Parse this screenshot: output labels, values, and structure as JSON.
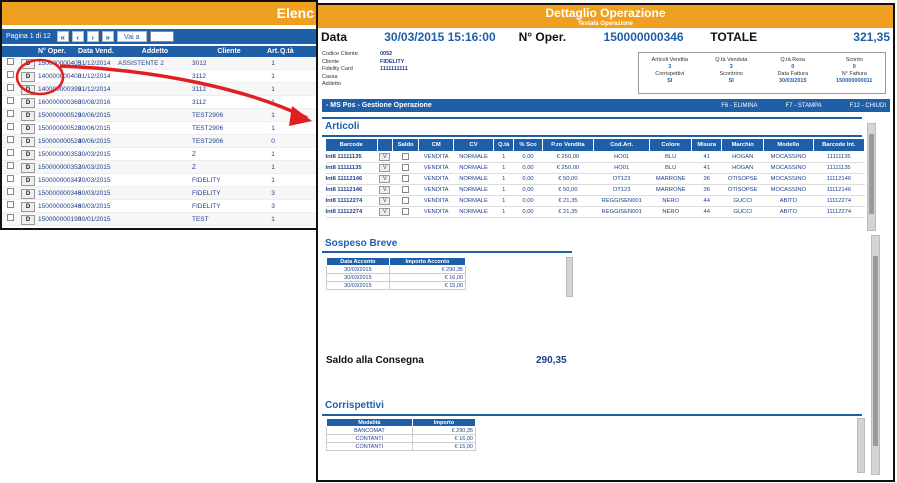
{
  "left": {
    "title": "Elenc",
    "pager": {
      "text": "Pagina 1 di 12",
      "first": "«",
      "prev": "‹",
      "next": "›",
      "last": "»",
      "goto": "Vai a",
      "goto_value": ""
    },
    "columns": [
      "",
      "",
      "N° Oper.",
      "Data Vend.",
      "Addetto",
      "Cliente",
      "Art.",
      "Q.tà"
    ],
    "rows": [
      {
        "d": "D",
        "op": "150000000405",
        "data": "31/12/2014",
        "addetto": "ASSISTENTE 2",
        "cliente": "3012",
        "art": "1"
      },
      {
        "d": "D",
        "op": "140000000400",
        "data": "31/12/2014",
        "addetto": "",
        "cliente": "3112",
        "art": "1"
      },
      {
        "d": "D",
        "op": "140000000399",
        "data": "31/12/2014",
        "addetto": "",
        "cliente": "3112",
        "art": "1"
      },
      {
        "d": "D",
        "op": "160000000360",
        "data": "30/08/2016",
        "addetto": "",
        "cliente": "3112",
        "art": "1"
      },
      {
        "d": "D",
        "op": "150000000529",
        "data": "30/06/2015",
        "addetto": "",
        "cliente": "TEST2906",
        "art": "1"
      },
      {
        "d": "D",
        "op": "150000000528",
        "data": "30/06/2015",
        "addetto": "",
        "cliente": "TEST2906",
        "art": "1"
      },
      {
        "d": "D",
        "op": "150000000524",
        "data": "30/06/2015",
        "addetto": "",
        "cliente": "TEST2906",
        "art": "0"
      },
      {
        "d": "D",
        "op": "150000000353",
        "data": "30/03/2015",
        "addetto": "",
        "cliente": "Z",
        "art": "1"
      },
      {
        "d": "D",
        "op": "150000000352",
        "data": "30/03/2015",
        "addetto": "",
        "cliente": "Z",
        "art": "1"
      },
      {
        "d": "D",
        "op": "150000000347",
        "data": "30/03/2015",
        "addetto": "",
        "cliente": "FIDELITY",
        "art": "1"
      },
      {
        "d": "D",
        "op": "150000000346",
        "data": "30/03/2015",
        "addetto": "",
        "cliente": "FIDELITY",
        "art": "3"
      },
      {
        "d": "D",
        "op": "150000000346",
        "data": "30/03/2015",
        "addetto": "",
        "cliente": "FIDELITY",
        "art": "3"
      },
      {
        "d": "D",
        "op": "150000000190",
        "data": "30/01/2015",
        "addetto": "",
        "cliente": "TEST",
        "art": "1"
      }
    ]
  },
  "right": {
    "title": "Dettaglio Operazione",
    "subtitle": "Testata Operazione",
    "data_label": "Data",
    "data_value": "30/03/2015 15:16:00",
    "oper_label": "N° Oper.",
    "oper_value": "150000000346",
    "totale_label": "TOTALE",
    "totale_value": "321,35",
    "info": [
      {
        "label": "Codice Cliente",
        "value": "0052"
      },
      {
        "label": "Cliente",
        "value": "FIDELITY"
      },
      {
        "label": "Fidelity Card",
        "value": "1111111111"
      },
      {
        "label": "Cassa",
        "value": ""
      },
      {
        "label": "Addetto",
        "value": ""
      }
    ],
    "box": [
      {
        "label": "Articoli Vendita",
        "value": "3"
      },
      {
        "label": "Q.tà Venduta",
        "value": "3"
      },
      {
        "label": "Q.tà Resa",
        "value": "0"
      },
      {
        "label": "Sconto",
        "value": "0"
      },
      {
        "label": "Corrispettivi",
        "value": "SI"
      },
      {
        "label": "Scontrino",
        "value": "SI"
      },
      {
        "label": "Data Fattura",
        "value": "30/03/2015"
      },
      {
        "label": "N° Fattura",
        "value": "150000000011"
      }
    ],
    "mspos": {
      "title": "- MS Pos - Gestione Operazione",
      "f6": "F6 - ELIMINA",
      "f7": "F7 - STAMPA",
      "f12": "F12 - CHIUDI"
    },
    "articoli": {
      "title": "Articoli",
      "columns": [
        "Barcode",
        "",
        "Saldo",
        "CM",
        "CV",
        "Q.tà",
        "% Sco",
        "P.zo Vendita",
        "Cod.Art.",
        "Colore",
        "Misura",
        "Marchio",
        "Modello",
        "Barcode Int."
      ],
      "rows": [
        {
          "barcode": "Int8 11111135",
          "v": "V",
          "cm": "VENDITA",
          "cv": "NORMALE",
          "qta": "1",
          "sco": "0,00",
          "prezzo": "€ 250,00",
          "cod": "HO01",
          "colore": "BLU",
          "misura": "41",
          "marchio": "HOGAN",
          "modello": "MOCASSINO",
          "bint": "11111135"
        },
        {
          "barcode": "Int8 11111135",
          "v": "V",
          "cm": "VENDITA",
          "cv": "NORMALE",
          "qta": "1",
          "sco": "0,00",
          "prezzo": "€ 250,00",
          "cod": "HO01",
          "colore": "BLU",
          "misura": "41",
          "marchio": "HOGAN",
          "modello": "MOCASSINO",
          "bint": "11111135"
        },
        {
          "barcode": "Int8 11112146",
          "v": "V",
          "cm": "VENDITA",
          "cv": "NORMALE",
          "qta": "1",
          "sco": "0,00",
          "prezzo": "€ 50,00",
          "cod": "OT123",
          "colore": "MARRONE",
          "misura": "36",
          "marchio": "OTISOPSE",
          "modello": "MOCASSINO",
          "bint": "11112146"
        },
        {
          "barcode": "Int8 11112146",
          "v": "V",
          "cm": "VENDITA",
          "cv": "NORMALE",
          "qta": "1",
          "sco": "0,00",
          "prezzo": "€ 50,00",
          "cod": "OT123",
          "colore": "MARRONE",
          "misura": "36",
          "marchio": "OTISOPSE",
          "modello": "MOCASSINO",
          "bint": "11112146"
        },
        {
          "barcode": "Int8 11112274",
          "v": "V",
          "cm": "VENDITA",
          "cv": "NORMALE",
          "qta": "1",
          "sco": "0,00",
          "prezzo": "€ 21,35",
          "cod": "REGGISEN001",
          "colore": "NERO",
          "misura": "44",
          "marchio": "GUCCI",
          "modello": "ABITO",
          "bint": "11112274"
        },
        {
          "barcode": "Int8 11112274",
          "v": "V",
          "cm": "VENDITA",
          "cv": "NORMALE",
          "qta": "1",
          "sco": "0,00",
          "prezzo": "€ 21,35",
          "cod": "REGGISEN001",
          "colore": "NERO",
          "misura": "44",
          "marchio": "GUCCI",
          "modello": "ABITO",
          "bint": "11112274"
        }
      ]
    },
    "sospeso": {
      "title": "Sospeso Breve",
      "columns": [
        "Data Acconto",
        "Importo Acconto"
      ],
      "rows": [
        {
          "data": "30/03/2015",
          "importo": "€ 290,35"
        },
        {
          "data": "30/03/2015",
          "importo": "€ 16,00"
        },
        {
          "data": "30/03/2015",
          "importo": "€ 15,00"
        }
      ]
    },
    "saldo_label": "Saldo alla Consegna",
    "saldo_value": "290,35",
    "corrispettivi": {
      "title": "Corrispettivi",
      "columns": [
        "Modalità",
        "Importo"
      ],
      "rows": [
        {
          "mod": "BANCOMAT",
          "importo": "€ 290,35"
        },
        {
          "mod": "CONTANTI",
          "importo": "€ 16,00"
        },
        {
          "mod": "CONTANTI",
          "importo": "€ 15,00"
        }
      ]
    }
  },
  "colors": {
    "accent": "#1f5fa8",
    "header": "#f0a020",
    "annotation": "#e02020"
  }
}
